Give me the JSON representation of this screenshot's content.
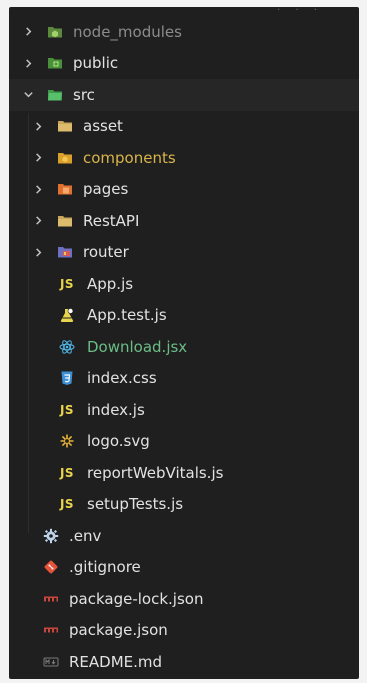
{
  "explorer": {
    "items": [
      {
        "label": "node_modules",
        "kind": "folder",
        "expanded": false,
        "icon": "node-modules-folder-icon",
        "color": "#8c8c8c"
      },
      {
        "label": "public",
        "kind": "folder",
        "expanded": false,
        "icon": "public-folder-icon",
        "color": "#e2e2e2"
      },
      {
        "label": "src",
        "kind": "folder",
        "expanded": true,
        "icon": "src-folder-icon",
        "color": "#e2e2e2"
      },
      {
        "label": "asset",
        "kind": "folder",
        "expanded": false,
        "icon": "folder-icon",
        "color": "#e2e2e2"
      },
      {
        "label": "components",
        "kind": "folder",
        "expanded": false,
        "icon": "components-folder-icon",
        "color": "#d8b44a"
      },
      {
        "label": "pages",
        "kind": "folder",
        "expanded": false,
        "icon": "pages-folder-icon",
        "color": "#e2e2e2"
      },
      {
        "label": "RestAPI",
        "kind": "folder",
        "expanded": false,
        "icon": "folder-icon",
        "color": "#e2e2e2"
      },
      {
        "label": "router",
        "kind": "folder",
        "expanded": false,
        "icon": "router-folder-icon",
        "color": "#e2e2e2"
      },
      {
        "label": "App.js",
        "kind": "file",
        "icon": "js-file-icon",
        "color": "#e2e2e2"
      },
      {
        "label": "App.test.js",
        "kind": "file",
        "icon": "test-file-icon",
        "color": "#e2e2e2"
      },
      {
        "label": "Download.jsx",
        "kind": "file",
        "icon": "react-file-icon",
        "color": "#6bbd86"
      },
      {
        "label": "index.css",
        "kind": "file",
        "icon": "css-file-icon",
        "color": "#e2e2e2"
      },
      {
        "label": "index.js",
        "kind": "file",
        "icon": "js-file-icon",
        "color": "#e2e2e2"
      },
      {
        "label": "logo.svg",
        "kind": "file",
        "icon": "svg-file-icon",
        "color": "#e2e2e2"
      },
      {
        "label": "reportWebVitals.js",
        "kind": "file",
        "icon": "js-file-icon",
        "color": "#e2e2e2"
      },
      {
        "label": "setupTests.js",
        "kind": "file",
        "icon": "js-file-icon",
        "color": "#e2e2e2"
      },
      {
        "label": ".env",
        "kind": "file",
        "icon": "gear-icon",
        "color": "#e2e2e2"
      },
      {
        "label": ".gitignore",
        "kind": "file",
        "icon": "git-icon",
        "color": "#e2e2e2"
      },
      {
        "label": "package-lock.json",
        "kind": "file",
        "icon": "npm-icon",
        "color": "#e2e2e2"
      },
      {
        "label": "package.json",
        "kind": "file",
        "icon": "npm-icon",
        "color": "#e2e2e2"
      },
      {
        "label": "README.md",
        "kind": "file",
        "icon": "markdown-icon",
        "color": "#e2e2e2"
      }
    ],
    "js_badge": "JS"
  }
}
